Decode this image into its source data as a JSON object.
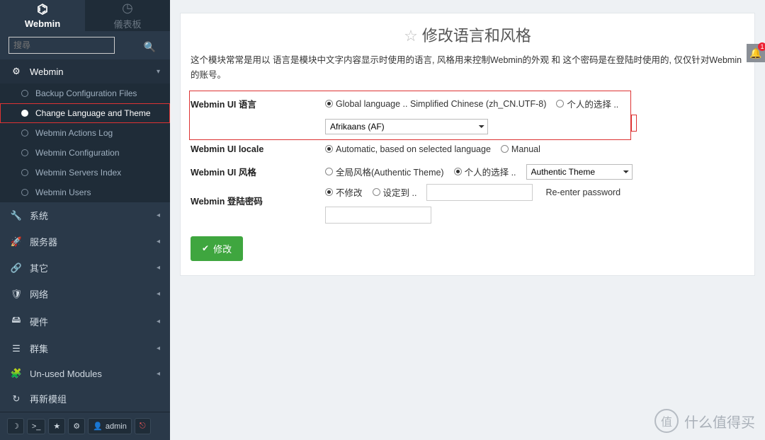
{
  "tabs": {
    "webmin": "Webmin",
    "dashboard": "儀表板"
  },
  "search": {
    "placeholder": "搜尋"
  },
  "sidebar": {
    "webmin": {
      "label": "Webmin",
      "items": [
        "Backup Configuration Files",
        "Change Language and Theme",
        "Webmin Actions Log",
        "Webmin Configuration",
        "Webmin Servers Index",
        "Webmin Users"
      ]
    },
    "cats": [
      "系统",
      "服务器",
      "其它",
      "网络",
      "硬件",
      "群集",
      "Un-used Modules",
      "再新模组"
    ]
  },
  "bottombar": {
    "admin_label": "admin"
  },
  "page": {
    "title": "修改语言和风格",
    "desc": "这个模块常常是用以 语言是模块中文字内容显示时使用的语言, 风格用来控制Webmin的外观 和 这个密码是在登陆时使用的, 仅仅针对Webmin的账号。",
    "rows": {
      "lang_label": "Webmin UI 语言",
      "lang_global": "Global language .. Simplified Chinese (zh_CN.UTF-8)",
      "lang_personal": "个人的选择 ..",
      "lang_select": "Afrikaans (AF)",
      "locale_label": "Webmin UI locale",
      "locale_auto": "Automatic, based on selected language",
      "locale_manual": "Manual",
      "theme_label": "Webmin UI 风格",
      "theme_global": "全局风格(Authentic Theme)",
      "theme_personal": "个人的选择 ..",
      "theme_select": "Authentic Theme",
      "pwd_label": "Webmin 登陆密码",
      "pwd_nochange": "不修改",
      "pwd_setto": "设定到 ..",
      "pwd_reenter": "Re-enter password"
    },
    "submit": "修改"
  },
  "bell": {
    "count": "1"
  },
  "watermark": {
    "char": "值",
    "text": "什么值得买"
  }
}
